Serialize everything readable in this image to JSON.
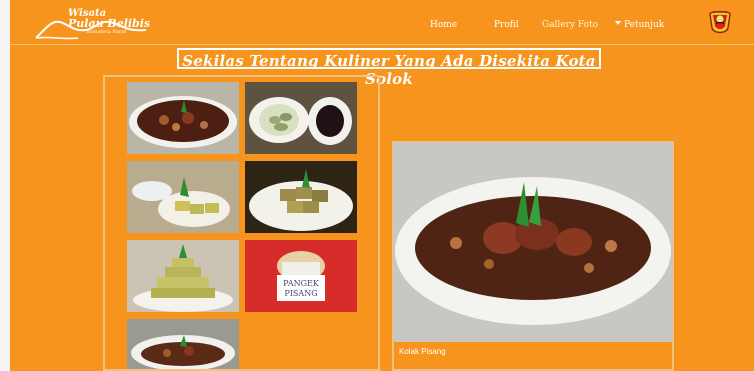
{
  "brand": {
    "name_line1": "Wisata",
    "name_line2": "Pulau Belibis",
    "tagline": "Sumatera Barat"
  },
  "nav": {
    "items": [
      {
        "label": "Home",
        "active": false
      },
      {
        "label": "Profil",
        "active": false
      },
      {
        "label": "Gallery Foto",
        "active": true,
        "dropdown": true
      },
      {
        "label": "Petunjuk",
        "active": false
      }
    ]
  },
  "page_title": "Sekilas Tentang Kuliner Yang Ada Disekita Kota Solok",
  "gallery": {
    "thumbnails": [
      {
        "subject": "dark-dessert-bowl"
      },
      {
        "subject": "green-cakes-and-sauce"
      },
      {
        "subject": "rolled-green-snacks"
      },
      {
        "subject": "layered-green-cakes"
      },
      {
        "subject": "stacked-cake-tower"
      },
      {
        "subject": "pangek-pisang-jar",
        "label_line1": "PANGEK",
        "label_line2": "PISANG"
      },
      {
        "subject": "partial-dessert-bowl"
      }
    ],
    "featured_caption": "Kolak Pisang"
  },
  "colors": {
    "background": "#f7941d",
    "border": "#f1c27a",
    "text": "#ffffff"
  }
}
